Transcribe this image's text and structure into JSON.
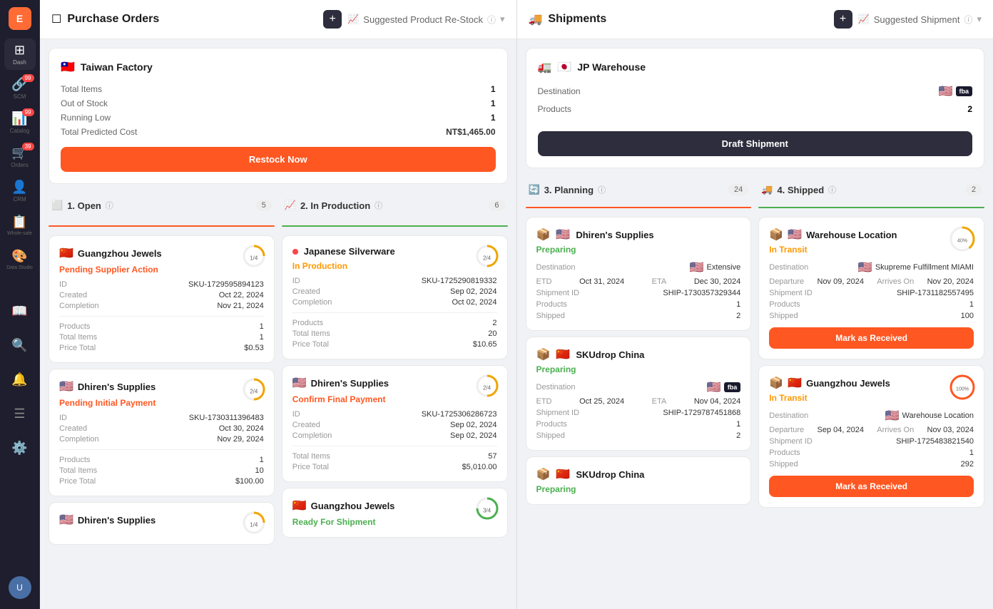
{
  "sidebar": {
    "logo": "E",
    "items": [
      {
        "id": "dash",
        "label": "Dash",
        "icon": "⊞",
        "active": false,
        "badge": null
      },
      {
        "id": "scm",
        "label": "SCM",
        "icon": "🔗",
        "active": true,
        "badge": "99"
      },
      {
        "id": "catalog",
        "label": "Catalog",
        "icon": "📊",
        "active": false,
        "badge": "99"
      },
      {
        "id": "orders",
        "label": "Orders",
        "icon": "🛒",
        "active": false,
        "badge": "39"
      },
      {
        "id": "crm",
        "label": "CRM",
        "icon": "👤",
        "active": false,
        "badge": null
      },
      {
        "id": "wholesale",
        "label": "Whole-sale",
        "icon": "📋",
        "active": false,
        "badge": null
      },
      {
        "id": "data-studio",
        "label": "Data Studio",
        "icon": "🎨",
        "active": false,
        "badge": null
      },
      {
        "id": "book",
        "label": "",
        "icon": "📖",
        "active": false,
        "badge": null
      },
      {
        "id": "search",
        "label": "",
        "icon": "🔍",
        "active": false,
        "badge": null
      },
      {
        "id": "bell",
        "label": "",
        "icon": "🔔",
        "active": false,
        "badge": null
      },
      {
        "id": "list",
        "label": "",
        "icon": "☰",
        "active": false,
        "badge": null
      },
      {
        "id": "settings",
        "label": "",
        "icon": "⚙️",
        "active": false,
        "badge": null
      }
    ]
  },
  "purchase_orders": {
    "title": "Purchase Orders",
    "suggested_label": "Suggested Product Re-Stock",
    "factory_card": {
      "flag": "🇹🇼",
      "name": "Taiwan Factory",
      "total_items_label": "Total Items",
      "total_items_value": "1",
      "out_of_stock_label": "Out of Stock",
      "out_of_stock_value": "1",
      "running_low_label": "Running Low",
      "running_low_value": "1",
      "total_cost_label": "Total Predicted Cost",
      "total_cost_value": "NT$1,465.00",
      "restock_btn": "Restock Now"
    },
    "open_section": {
      "icon": "⬜",
      "title": "1. Open",
      "count": "5",
      "cards": [
        {
          "flag": "🇨🇳",
          "supplier": "Guangzhou Jewels",
          "status": "Pending Supplier Action",
          "status_type": "pending",
          "id_label": "ID",
          "id_value": "SKU-1729595894123",
          "created_label": "Created",
          "created_value": "Oct 22, 2024",
          "completion_label": "Completion",
          "completion_value": "Nov 21, 2024",
          "products_label": "Products",
          "products_value": "1",
          "total_items_label": "Total Items",
          "total_items_value": "1",
          "price_label": "Price Total",
          "price_value": "$0.53",
          "progress": "1/4",
          "progress_pct": 25
        },
        {
          "flag": "🇺🇸",
          "supplier": "Dhiren's Supplies",
          "status": "Pending Initial Payment",
          "status_type": "pending",
          "id_label": "ID",
          "id_value": "SKU-1730311396483",
          "created_label": "Created",
          "created_value": "Oct 30, 2024",
          "completion_label": "Completion",
          "completion_value": "Nov 29, 2024",
          "products_label": "Products",
          "products_value": "1",
          "total_items_label": "Total Items",
          "total_items_value": "10",
          "price_label": "Price Total",
          "price_value": "$100.00",
          "progress": "2/4",
          "progress_pct": 50
        },
        {
          "flag": "🇺🇸",
          "supplier": "Dhiren's Supplies",
          "status": "",
          "status_type": "none",
          "id_label": "ID",
          "id_value": "",
          "progress": "1/4",
          "progress_pct": 25
        }
      ]
    },
    "in_production_section": {
      "icon": "📈",
      "title": "2. In Production",
      "count": "6",
      "cards": [
        {
          "flag": "🇯🇵",
          "supplier": "Japanese Silverware",
          "dot": "red",
          "status": "In Production",
          "status_type": "inprod",
          "id_label": "ID",
          "id_value": "SKU-1725290819332",
          "created_label": "Created",
          "created_value": "Sep 02, 2024",
          "completion_label": "Completion",
          "completion_value": "Oct 02, 2024",
          "products_label": "Products",
          "products_value": "2",
          "total_items_label": "Total Items",
          "total_items_value": "20",
          "price_label": "Price Total",
          "price_value": "$10.65",
          "progress": "2/4",
          "progress_pct": 50
        },
        {
          "flag": "🇺🇸",
          "supplier": "Dhiren's Supplies",
          "status": "Confirm Final Payment",
          "status_type": "pending",
          "id_label": "ID",
          "id_value": "SKU-1725306286723",
          "created_label": "Created",
          "created_value": "Sep 02, 2024",
          "completion_label": "Completion",
          "completion_value": "Sep 02, 2024",
          "products_label": "Products",
          "products_value": "",
          "total_items_label": "Total Items",
          "total_items_value": "57",
          "price_label": "Price Total",
          "price_value": "$5,010.00",
          "progress": "2/4",
          "progress_pct": 50
        },
        {
          "flag": "🇨🇳",
          "supplier": "Guangzhou Jewels",
          "status": "Ready For Shipment",
          "status_type": "ready",
          "id_label": "ID",
          "id_value": "",
          "progress": "3/4",
          "progress_pct": 75
        }
      ]
    }
  },
  "shipments": {
    "title": "Shipments",
    "suggested_label": "Suggested Shipment",
    "warehouse_card": {
      "icon": "🚛",
      "flag": "🇯🇵",
      "name": "JP Warehouse",
      "destination_label": "Destination",
      "destination_flag": "🇺🇸",
      "destination_badge": "fba",
      "products_label": "Products",
      "products_value": "2",
      "draft_btn": "Draft Shipment"
    },
    "planning_section": {
      "icon": "🔄",
      "title": "3. Planning",
      "count": "24",
      "cards": [
        {
          "icon": "📦",
          "flag": "🇺🇸",
          "supplier": "Dhiren's Supplies",
          "status": "Preparing",
          "status_type": "preparing",
          "destination_label": "Destination",
          "destination_flag": "🇺🇸",
          "destination_value": "Extensive",
          "etd_label": "ETD",
          "etd_value": "Oct 31, 2024",
          "eta_label": "ETA",
          "eta_value": "Dec 30, 2024",
          "shipment_id_label": "Shipment ID",
          "shipment_id_value": "SHIP-1730357329344",
          "products_label": "Products",
          "products_value": "1",
          "shipped_label": "Shipped",
          "shipped_value": "2"
        },
        {
          "icon": "📦",
          "flag": "🇨🇳",
          "supplier": "SKUdrop China",
          "status": "Preparing",
          "status_type": "preparing",
          "destination_label": "Destination",
          "destination_flag": "🇺🇸",
          "destination_badge": "fba",
          "etd_label": "ETD",
          "etd_value": "Oct 25, 2024",
          "eta_label": "ETA",
          "eta_value": "Nov 04, 2024",
          "shipment_id_label": "Shipment ID",
          "shipment_id_value": "SHIP-1729787451868",
          "products_label": "Products",
          "products_value": "1",
          "shipped_label": "Shipped",
          "shipped_value": "2"
        },
        {
          "icon": "📦",
          "flag": "🇨🇳",
          "supplier": "SKUdrop China",
          "status": "Preparing",
          "status_type": "preparing"
        }
      ]
    },
    "shipped_section": {
      "icon": "🚚",
      "title": "4. Shipped",
      "count": "2",
      "cards": [
        {
          "icon": "📦",
          "flag": "🇺🇸",
          "supplier": "Warehouse Location",
          "status": "In Transit",
          "status_type": "intransit",
          "destination_label": "Destination",
          "destination_flag": "🇺🇸",
          "destination_value": "Skupreme Fulfillment MIAMI",
          "departure_label": "Departure",
          "departure_value": "Nov 09, 2024",
          "arrives_label": "Arrives On",
          "arrives_value": "Nov 20, 2024",
          "shipment_id_label": "Shipment ID",
          "shipment_id_value": "SHIP-1731182557495",
          "products_label": "Products",
          "products_value": "1",
          "shipped_label": "Shipped",
          "shipped_value": "100",
          "progress_pct": 40,
          "mark_btn": "Mark as Received"
        },
        {
          "icon": "📦",
          "flag": "🇨🇳",
          "supplier": "Guangzhou Jewels",
          "status": "In Transit",
          "status_type": "intransit",
          "destination_label": "Destination",
          "destination_flag": "🇺🇸",
          "destination_value": "Warehouse Location",
          "departure_label": "Departure",
          "departure_value": "Sep 04, 2024",
          "arrives_label": "Arrives On",
          "arrives_value": "Nov 03, 2024",
          "shipment_id_label": "Shipment ID",
          "shipment_id_value": "SHIP-1725483821540",
          "products_label": "Products",
          "products_value": "1",
          "shipped_label": "Shipped",
          "shipped_value": "292",
          "progress_pct": 100,
          "mark_btn": "Mark as Received"
        }
      ]
    }
  }
}
